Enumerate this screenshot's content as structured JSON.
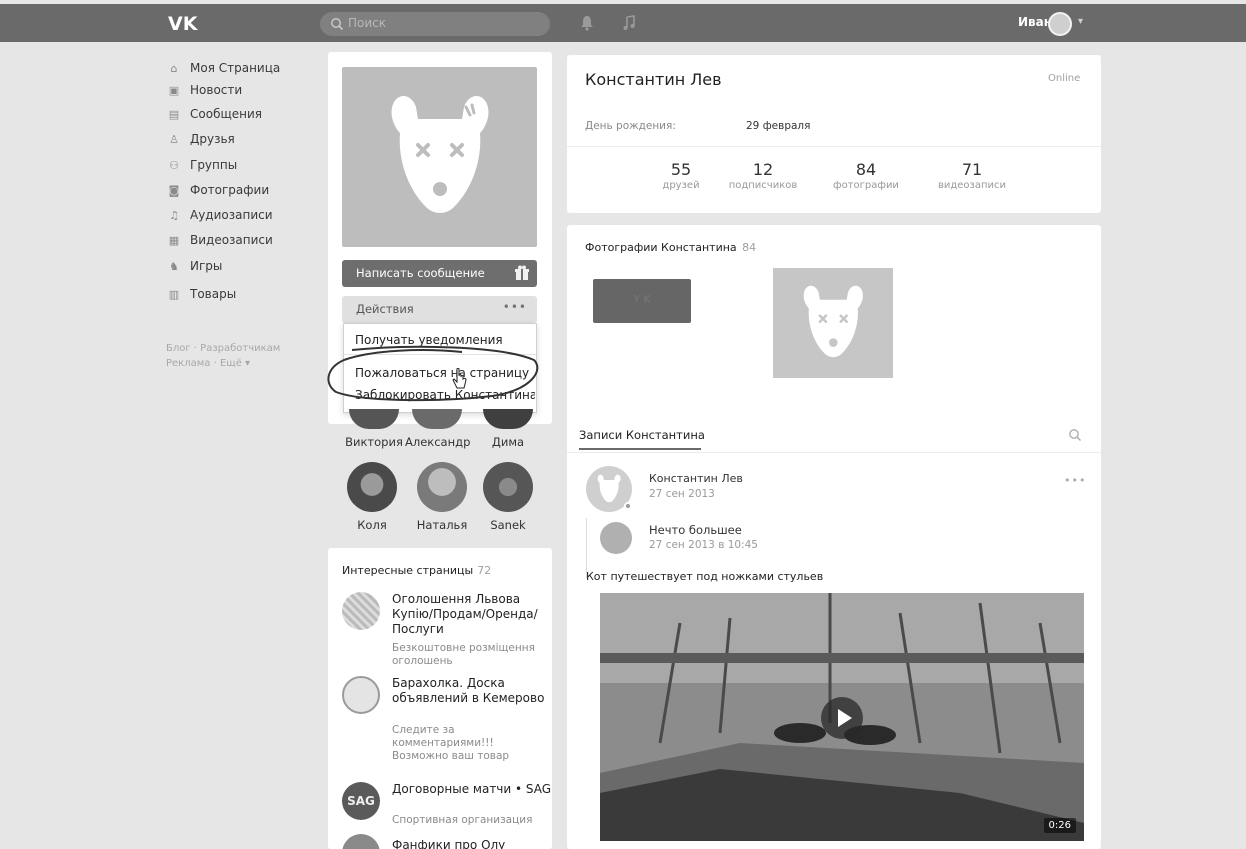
{
  "topbar": {
    "search_placeholder": "Поиск",
    "user_name": "Иван"
  },
  "nav": {
    "items": [
      {
        "label": "Моя Страница",
        "icon": "home-icon"
      },
      {
        "label": "Новости",
        "icon": "news-icon"
      },
      {
        "label": "Сообщения",
        "icon": "messages-icon"
      },
      {
        "label": "Друзья",
        "icon": "friends-icon"
      },
      {
        "label": "Группы",
        "icon": "groups-icon"
      },
      {
        "label": "Фотографии",
        "icon": "camera-icon"
      },
      {
        "label": "Аудиозаписи",
        "icon": "music-note-icon"
      },
      {
        "label": "Видеозаписи",
        "icon": "video-icon"
      },
      {
        "label": "Игры",
        "icon": "gamepad-icon"
      },
      {
        "label": "Товары",
        "icon": "bag-icon"
      }
    ],
    "footer_line1": "Блог · Разработчикам",
    "footer_line2": "Реклама · Ещё ▾"
  },
  "profile_actions": {
    "message_button": "Написать сообщение",
    "actions_button": "Действия",
    "more_dots": "•••",
    "dropdown": [
      "Получать уведомления",
      "Пожаловаться на страницу",
      "Заблокировать Константина"
    ]
  },
  "friends": [
    {
      "name": "Виктория"
    },
    {
      "name": "Александр"
    },
    {
      "name": "Дима"
    },
    {
      "name": "Коля"
    },
    {
      "name": "Наталья"
    },
    {
      "name": "Sanek"
    }
  ],
  "interesting_pages": {
    "title": "Интересные страницы",
    "count": "72",
    "items": [
      {
        "name": "Оголошення Львова Купiю/Продам/Оренда/Послуги",
        "desc": "Безкоштовне розмiщення оголошень"
      },
      {
        "name": "Барахолка. Доска объявлений в Кемерово",
        "desc": "Следите за комментариями!!! Возможно ваш товар"
      },
      {
        "name": "Договорные матчи • SAG",
        "desc": "Спортивная организация",
        "logo_text": "SAG"
      },
      {
        "name": "Фанфики про Олу",
        "desc": ""
      }
    ]
  },
  "profile": {
    "name": "Константин Лев",
    "status": "Online",
    "birthday_label": "День рождения:",
    "birthday_value": "29 февраля",
    "stats": [
      {
        "value": "55",
        "label": "друзей"
      },
      {
        "value": "12",
        "label": "подписчиков"
      },
      {
        "value": "84",
        "label": "фотографии"
      },
      {
        "value": "71",
        "label": "видеозаписи"
      }
    ]
  },
  "photos": {
    "title": "Фотографии Константина",
    "count": "84",
    "dark_thumb_label": "Y K"
  },
  "wall": {
    "tab_label": "Записи Константина",
    "post": {
      "author": "Константин Лев",
      "date": "27 сен 2013",
      "more": "•••",
      "repost_author": "Нечто большее",
      "repost_date": "27 сен 2013 в 10:45",
      "text": "Кот путешествует под ножками стульев",
      "video_duration": "0:26"
    }
  }
}
